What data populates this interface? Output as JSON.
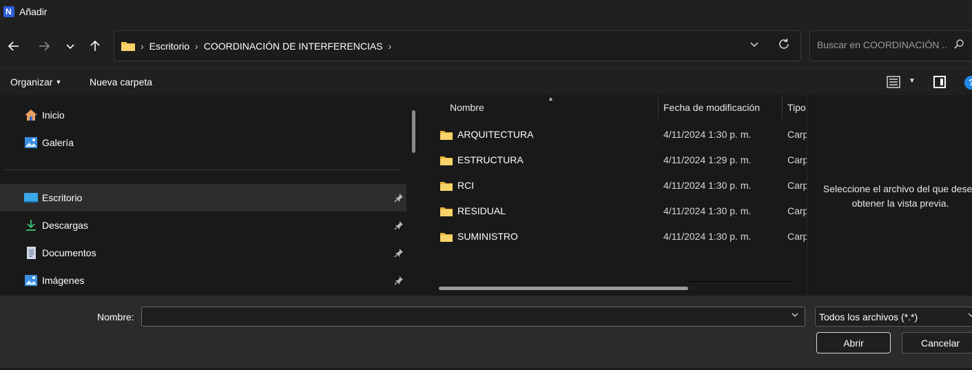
{
  "window": {
    "title": "Añadir",
    "icon": "app-logo-icon"
  },
  "address_bar": {
    "breadcrumbs": [
      "Escritorio",
      "COORDINACIÓN DE INTERFERENCIAS"
    ],
    "search_placeholder": "Buscar en COORDINACIÓN ..."
  },
  "commands": {
    "organize": "Organizar",
    "new_folder": "Nueva carpeta"
  },
  "sidebar": {
    "items": [
      {
        "label": "Inicio",
        "icon": "home-icon",
        "pinned": false,
        "selected": false
      },
      {
        "label": "Galería",
        "icon": "gallery-icon",
        "pinned": false,
        "selected": false
      },
      {
        "label": "Escritorio",
        "icon": "desktop-icon",
        "pinned": true,
        "selected": true
      },
      {
        "label": "Descargas",
        "icon": "download-icon",
        "pinned": true,
        "selected": false
      },
      {
        "label": "Documentos",
        "icon": "document-icon",
        "pinned": true,
        "selected": false
      },
      {
        "label": "Imágenes",
        "icon": "pictures-icon",
        "pinned": true,
        "selected": false
      }
    ]
  },
  "file_list": {
    "columns": [
      "Nombre",
      "Fecha de modificación",
      "Tipo"
    ],
    "rows": [
      {
        "name": "ARQUITECTURA",
        "date": "4/11/2024 1:30 p. m.",
        "type": "Carpeta de archivos"
      },
      {
        "name": "ESTRUCTURA",
        "date": "4/11/2024 1:29 p. m.",
        "type": "Carpeta de archivos"
      },
      {
        "name": "RCI",
        "date": "4/11/2024 1:30 p. m.",
        "type": "Carpeta de archivos"
      },
      {
        "name": "RESIDUAL",
        "date": "4/11/2024 1:30 p. m.",
        "type": "Carpeta de archivos"
      },
      {
        "name": "SUMINISTRO",
        "date": "4/11/2024 1:30 p. m.",
        "type": "Carpeta de archivos"
      }
    ]
  },
  "preview": {
    "line1": "Seleccione el archivo del que desea",
    "line2": "obtener la vista previa."
  },
  "footer": {
    "name_label": "Nombre:",
    "name_value": "",
    "filetype": "Todos los archivos (*.*)",
    "open_label": "Abrir",
    "cancel_label": "Cancelar"
  },
  "colors": {
    "background": "#191919",
    "chrome": "#202020",
    "footer": "#2b2b2b",
    "folder": "#f3c44c",
    "accent": "#1e88e5"
  }
}
